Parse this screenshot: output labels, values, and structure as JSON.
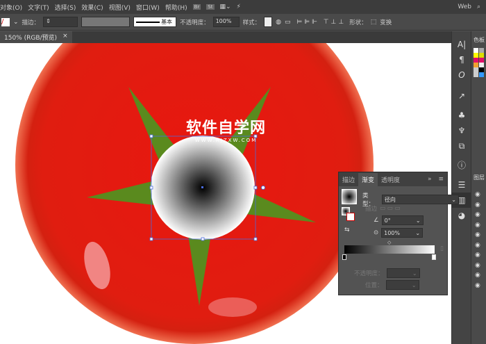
{
  "menu": [
    "对象(O)",
    "文字(T)",
    "选择(S)",
    "效果(C)",
    "视图(V)",
    "窗口(W)",
    "帮助(H)"
  ],
  "menu_icons": [
    "Br",
    "St"
  ],
  "workspace": "Web",
  "control": {
    "stroke_label": "描边：",
    "stroke_style": "基本",
    "opacity_label": "不透明度：",
    "opacity_value": "100%",
    "style_label": "样式：",
    "shape_label": "形状：",
    "transform_label": "变换"
  },
  "document_tab": {
    "title": "150% (RGB/预览)",
    "close": "×"
  },
  "watermark": {
    "text": "软件自学网",
    "url": "WWW.RJZXW.COM"
  },
  "gradient_panel": {
    "tabs": [
      "描边",
      "渐变",
      "透明度"
    ],
    "active_tab": "渐变",
    "type_label": "类型：",
    "type_value": "径向",
    "stroke_label": "描边",
    "angle_value": "0°",
    "aspect_value": "100%",
    "opacity_label": "不透明度：",
    "location_label": "位置："
  },
  "right_panels": {
    "color_label": "色板",
    "layers_label": "图层"
  },
  "colors": {
    "tomato": "#e8170f",
    "leaf": "#5a8a1e",
    "ui_bg": "#535353"
  }
}
